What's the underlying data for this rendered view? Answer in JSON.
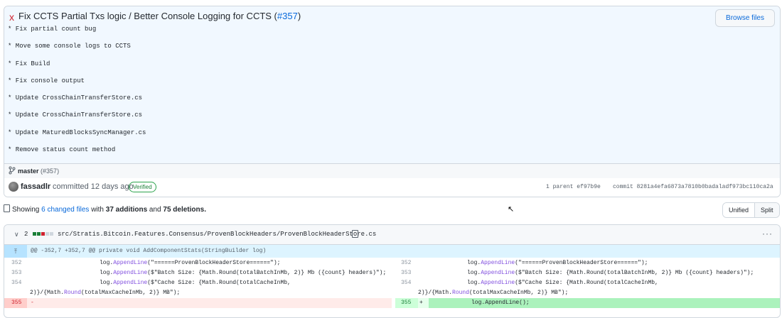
{
  "commit": {
    "status_icon": "x",
    "title_prefix": "Fix CCTS Partial Txs logic / Better Console Logging for CCTS (",
    "pr_link": "#357",
    "title_suffix": ")",
    "browse_files": "Browse files",
    "body_lines": [
      "* Fix partial count bug",
      "* Move some console logs to CCTS",
      "* Fix Build",
      "* Fix console output",
      "* Update CrossChainTransferStore.cs",
      "* Update CrossChainTransferStore.cs",
      "* Update MaturedBlocksSyncManager.cs",
      "* Remove status count method"
    ],
    "branch": "master",
    "branch_pr": "(#357)",
    "author": "fassadlr",
    "committed": "committed 12 days ago",
    "verified": "Verified",
    "parent_label": "1 parent",
    "parent_sha": "ef97b9e",
    "commit_label": "commit",
    "commit_sha": "8281a4efa6873a7810b0badaladf973bc110ca2a"
  },
  "summary": {
    "showing": "Showing",
    "changed_files": "6 changed files",
    "with": "with",
    "additions": "37 additions",
    "and": "and",
    "deletions": "75 deletions."
  },
  "view_toggle": {
    "unified": "Unified",
    "split": "Split"
  },
  "file": {
    "change_count": "2",
    "path": "src/Stratis.Bitcoin.Features.Consensus/ProvenBlockHeaders/ProvenBlockHeaderStore.cs",
    "more": "···",
    "hunk_header": "@@ -352,7 +352,7 @@ private void AddComponentStats(StringBuilder log)",
    "rows": [
      {
        "left_ln": "352",
        "left_pre": "log.",
        "left_method": "AppendLine",
        "left_post": "(\"======ProvenBlockHeaderStore======\");",
        "right_ln": "352",
        "right_pre": "log.",
        "right_method": "AppendLine",
        "right_post": "(\"======ProvenBlockHeaderStore======\");"
      },
      {
        "left_ln": "353",
        "left_pre": "log.",
        "left_method": "AppendLine",
        "left_post": "($\"Batch Size: {Math.Round(totalBatchInMb, 2)} Mb ({count} headers)\");",
        "right_ln": "353",
        "right_pre": "log.",
        "right_method": "AppendLine",
        "right_post": "($\"Batch Size: {Math.Round(totalBatchInMb, 2)} Mb ({count} headers)\");"
      },
      {
        "left_ln": "354",
        "left_pre": "log.",
        "left_method": "AppendLine",
        "left_post": "($\"Cache Size: {Math.Round(totalCacheInMb,",
        "right_ln": "354",
        "right_pre": "log.",
        "right_method": "AppendLine",
        "right_post": "($\"Cache Size: {Math.Round(totalCacheInMb,"
      }
    ],
    "wrap_left_pre": "2)}/{Math.",
    "wrap_left_method": "Round",
    "wrap_left_post": "(totalMaxCacheInMb, 2)} MB\");",
    "wrap_right_pre": "2)}/{Math.",
    "wrap_right_method": "Round",
    "wrap_right_post": "(totalMaxCacheInMb, 2)} MB\");",
    "del_ln": "355",
    "del_sign": "-",
    "add_ln": "355",
    "add_sign": "+",
    "add_code": "log.AppendLine();"
  }
}
